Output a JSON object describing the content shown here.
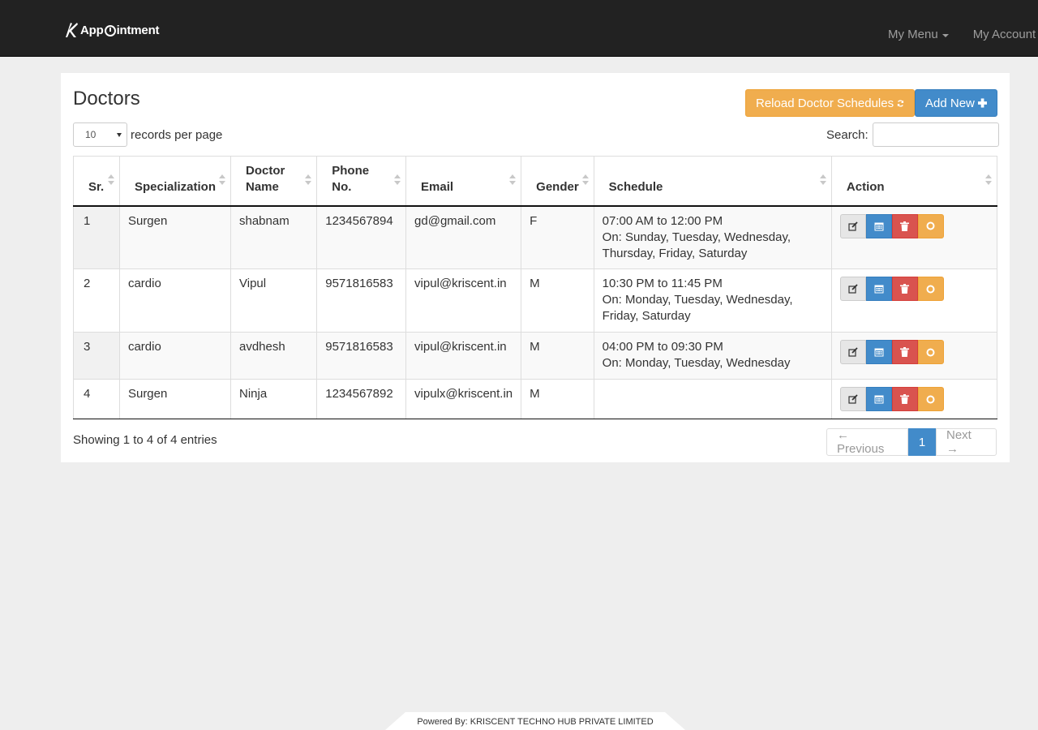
{
  "app": {
    "brand_prefix": "App",
    "brand_suffix": "intment"
  },
  "nav": {
    "menu_label": "My Menu",
    "account_label": "My Account"
  },
  "page": {
    "title": "Doctors",
    "reload_label": "Reload Doctor Schedules",
    "add_label": "Add New",
    "length_value": "10",
    "length_label": "records per page",
    "search_label": "Search:",
    "search_value": "",
    "info": "Showing 1 to 4 of 4 entries"
  },
  "table": {
    "headers": {
      "sr": "Sr.",
      "specialization": "Specialization",
      "doctor_1": "Doctor",
      "doctor_2": "Name",
      "phone": "Phone No.",
      "email": "Email",
      "gender": "Gender",
      "schedule": "Schedule",
      "action": "Action"
    },
    "rows": [
      {
        "sr": "1",
        "specialization": "Surgen",
        "name": "shabnam",
        "phone": "1234567894",
        "email": "gd@gmail.com",
        "gender": "F",
        "time": "07:00 AM to 12:00 PM",
        "days": "On: Sunday, Tuesday, Wednesday, Thursday, Friday, Saturday"
      },
      {
        "sr": "2",
        "specialization": "cardio",
        "name": "Vipul",
        "phone": "9571816583",
        "email": "vipul@kriscent.in",
        "gender": "M",
        "time": "10:30 PM to 11:45 PM",
        "days": "On: Monday, Tuesday, Wednesday, Friday, Saturday"
      },
      {
        "sr": "3",
        "specialization": "cardio",
        "name": "avdhesh",
        "phone": "9571816583",
        "email": "vipul@kriscent.in",
        "gender": "M",
        "time": "04:00 PM to 09:30 PM",
        "days": "On: Monday, Tuesday, Wednesday"
      },
      {
        "sr": "4",
        "specialization": "Surgen",
        "name": "Ninja",
        "phone": "1234567892",
        "email": "vipulx@kriscent.in",
        "gender": "M",
        "time": "",
        "days": ""
      }
    ]
  },
  "pagination": {
    "prev": "← Previous",
    "current": "1",
    "next": "Next →"
  },
  "footer": {
    "text": "Powered By: KRISCENT TECHNO HUB PRIVATE LIMITED"
  },
  "colors": {
    "primary": "#428bca",
    "warning": "#f0ad4e",
    "danger": "#d9534f",
    "navbar": "#222222"
  },
  "icons": {
    "edit": "edit-icon",
    "calendar": "calendar-icon",
    "delete": "trash-icon",
    "status": "circle-icon",
    "reload": "refresh-icon",
    "add": "plus-icon"
  }
}
